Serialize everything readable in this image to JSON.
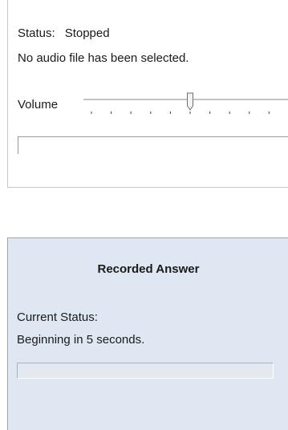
{
  "player": {
    "status_label": "Status:",
    "status_value": "Stopped",
    "message": "No audio file has been selected.",
    "volume_label": "Volume",
    "volume_level": 0.5
  },
  "answer": {
    "title": "Recorded Answer",
    "status_label": "Current Status:",
    "status_value": "Beginning in 5 seconds."
  }
}
